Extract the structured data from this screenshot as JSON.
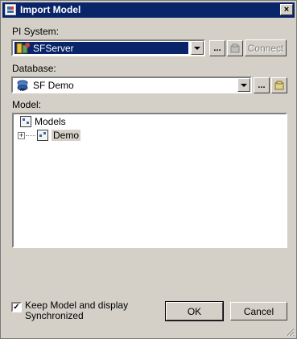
{
  "window": {
    "title": "Import Model",
    "close_label": "×"
  },
  "pi_system": {
    "label": "PI System:",
    "value": "SFServer",
    "browse_label": "...",
    "connect_label": "Connect"
  },
  "database": {
    "label": "Database:",
    "value": "SF Demo",
    "browse_label": "..."
  },
  "model": {
    "label": "Model:",
    "root": "Models",
    "child": "Demo",
    "expander": "+"
  },
  "options": {
    "sync_label_line1": "Keep Model and display",
    "sync_label_line2": "Synchronized",
    "checkmark": "✓"
  },
  "buttons": {
    "ok_label": "OK",
    "cancel_label": "Cancel"
  }
}
